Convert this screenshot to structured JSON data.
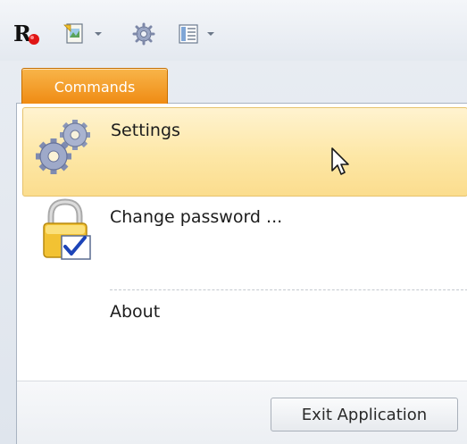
{
  "toolbar": {
    "app_icon": "r-app-icon",
    "items": [
      {
        "name": "document-icon",
        "has_dropdown": true
      },
      {
        "name": "gear-icon",
        "has_dropdown": false
      },
      {
        "name": "layout-icon",
        "has_dropdown": true
      }
    ]
  },
  "tabs": [
    {
      "label": "Commands",
      "active": true
    }
  ],
  "menu": {
    "items": [
      {
        "label": "Settings",
        "icon": "gears-icon",
        "highlighted": true
      },
      {
        "label": "Change password ...",
        "icon": "lock-check-icon",
        "highlighted": false
      },
      {
        "label": "About",
        "icon": "",
        "highlighted": false
      }
    ]
  },
  "footer": {
    "exit_label": "Exit Application"
  },
  "colors": {
    "tab_active": "#f39a1e",
    "highlight": "#fde7a6",
    "highlight_border": "#e6c26d"
  }
}
